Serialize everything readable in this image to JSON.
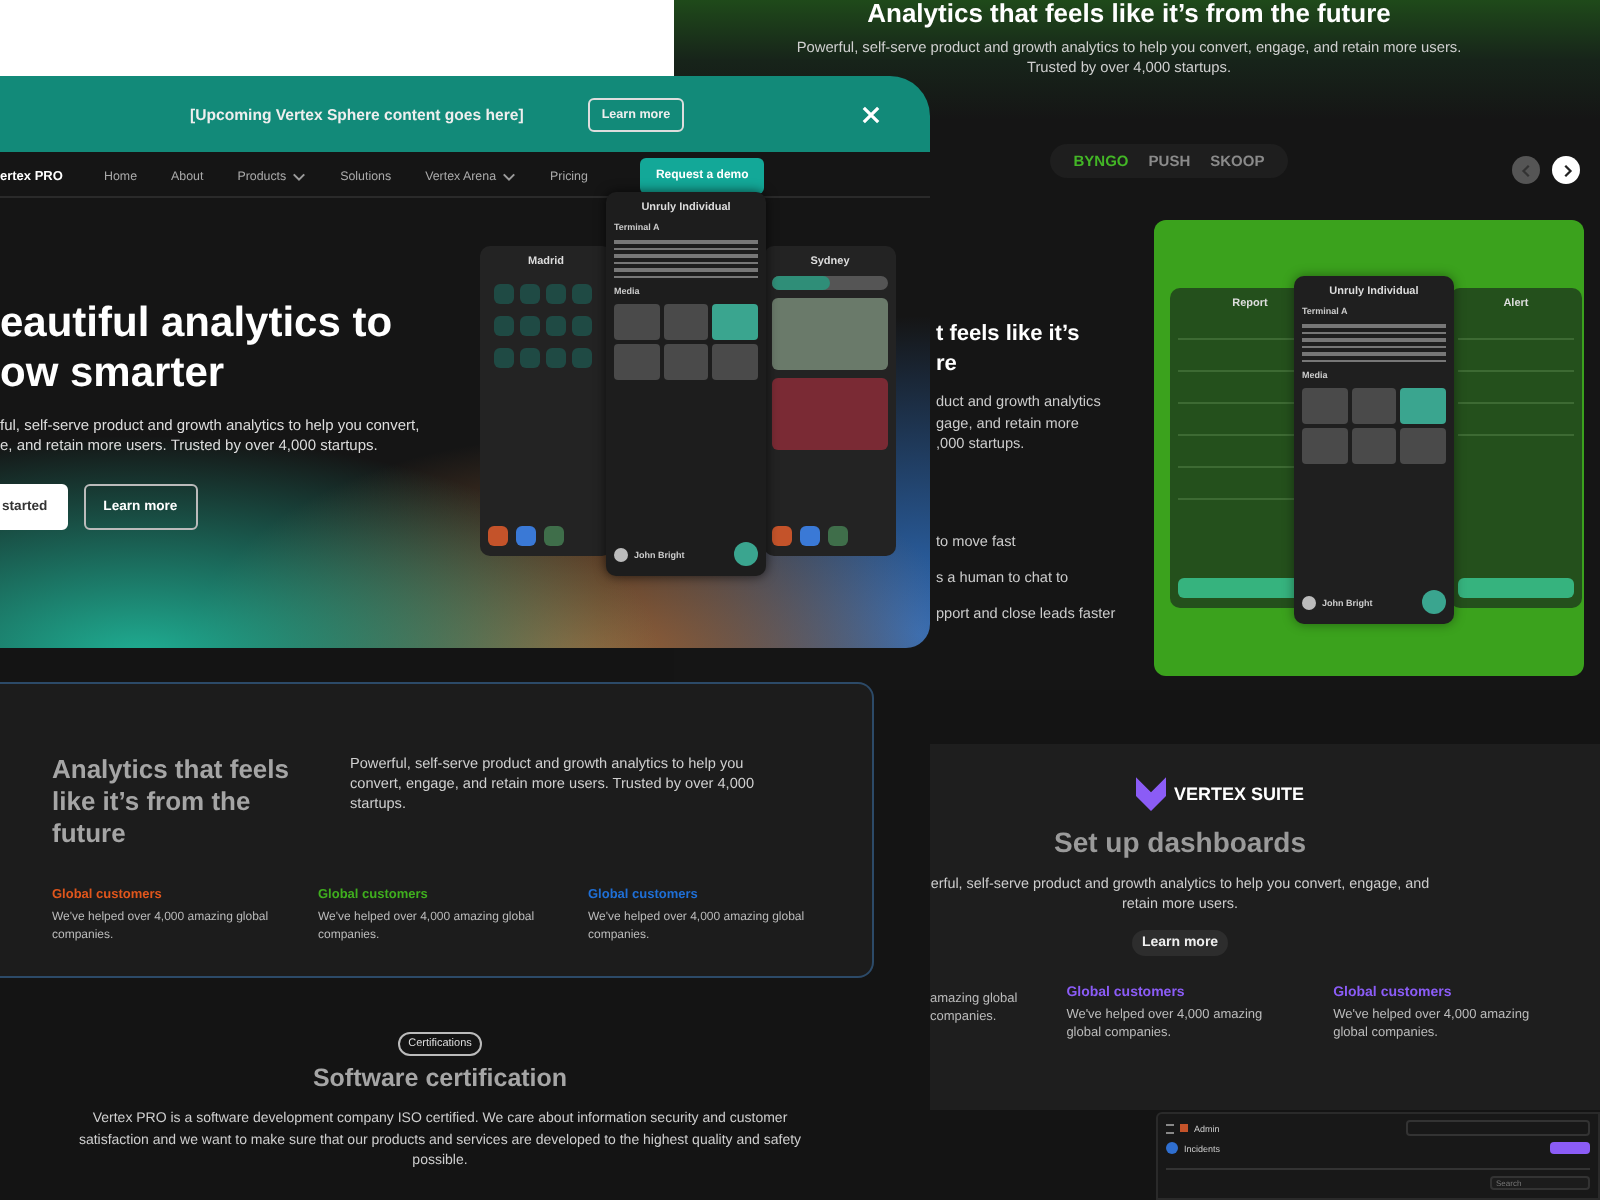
{
  "analytics_page": {
    "heading": "Analytics that feels like it’s from the future",
    "subtitle_lines": [
      "Powerful, self-serve product and growth analytics to help you convert, engage, and retain more users.",
      "Trusted by over 4,000 startups."
    ],
    "tabs": [
      {
        "label": "BYNGO",
        "selected": true
      },
      {
        "label": "PUSH",
        "selected": false
      },
      {
        "label": "SKOOP",
        "selected": false
      }
    ],
    "heading_fragment": [
      "t feels like it’s",
      "re"
    ],
    "body_fragment": [
      "duct and growth analytics",
      "gage, and retain more",
      ",000 startups."
    ],
    "list_fragments": [
      "to move fast",
      "s a human to chat to",
      "pport and close leads faster"
    ],
    "showcase_phones": [
      {
        "kind": "form",
        "title": "Report"
      },
      {
        "kind": "detail",
        "title": "Unruly Individual",
        "subtitle": "Terminal A",
        "media_label": "Media",
        "user": "John Bright"
      },
      {
        "kind": "alert",
        "title": "Alert"
      }
    ]
  },
  "sphere_page": {
    "banner": {
      "text": "[Upcoming Vertex Sphere content goes here]",
      "button": "Learn more"
    },
    "nav": {
      "brand": "ertex PRO",
      "links": [
        {
          "label": "Home",
          "dropdown": false
        },
        {
          "label": "About",
          "dropdown": false
        },
        {
          "label": "Products",
          "dropdown": true
        },
        {
          "label": "Solutions",
          "dropdown": false
        },
        {
          "label": "Vertex Arena",
          "dropdown": true
        },
        {
          "label": "Pricing",
          "dropdown": false
        }
      ],
      "cta": "Request a demo"
    },
    "hero": {
      "heading_lines": [
        "eautiful analytics to",
        "ow smarter"
      ],
      "text_lines": [
        "ful, self-serve product and growth analytics to help you convert,",
        "e, and retain more users. Trusted by over 4,000 startups."
      ],
      "buttons": [
        {
          "label": "started",
          "kind": "primary"
        },
        {
          "label": "Learn more",
          "kind": "outline"
        }
      ]
    },
    "phones": [
      {
        "kind": "grid",
        "title": "Madrid"
      },
      {
        "kind": "detail",
        "title": "Unruly Individual",
        "subtitle": "Terminal A",
        "media_label": "Media",
        "user": "John Bright"
      },
      {
        "kind": "feed",
        "title": "Sydney"
      }
    ]
  },
  "features_card": {
    "heading": "Analytics **that feels like** it’s **from the future**",
    "text": "Powerful, self-serve product and growth analytics to help you convert, engage, and retain more users. Trusted by over 4,000 startups.",
    "features": [
      {
        "title": "Global customers",
        "text": "We've helped over 4,000 amazing global companies.",
        "color": "#e0561c"
      },
      {
        "title": "Global customers",
        "text": "We've helped over 4,000 amazing global companies.",
        "color": "#3fae1e"
      },
      {
        "title": "Global customers",
        "text": "We've helped over 4,000 amazing global companies.",
        "color": "#1f6fd6"
      }
    ]
  },
  "certification": {
    "badge": "Certifications",
    "title": "Software **certification**",
    "text": "Vertex PRO is a software development company ISO certified. We care about information security and customer satisfaction and we want to make sure that our products and services are developed to the highest quality and safety possible."
  },
  "suite_page": {
    "brand": "VERTEX SUITE",
    "title": "Set up **dashboards**",
    "text": "erful, self-serve product and growth analytics to help you convert, engage, and retain more users.",
    "button": "Learn more",
    "features": [
      {
        "text": "amazing global companies."
      },
      {
        "title": "Global customers",
        "text": "We've helped over 4,000 amazing global companies."
      },
      {
        "title": "Global customers",
        "text": "We've helped over 4,000 amazing global companies."
      }
    ]
  },
  "admin_preview": {
    "app": "Admin",
    "section": "Incidents",
    "search_placeholder": "Search"
  }
}
